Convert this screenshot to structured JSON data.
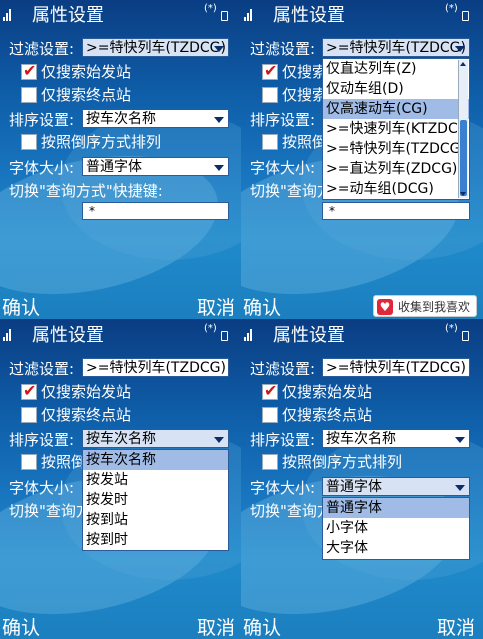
{
  "title": "属性设置",
  "bt_symbol": "(*)",
  "filter_label": "过滤设置:",
  "filter_value": ">=特快列车(TZDCG)",
  "search_start": "仅搜索始发站",
  "search_end": "仅搜索终点站",
  "sort_label": "排序设置:",
  "sort_value": "按车次名称",
  "reverse": "按照倒序方式排列",
  "font_label": "字体大小:",
  "font_value": "普通字体",
  "shortcut_label": "切换\"查询方式\"快捷键:",
  "shortcut_value": "*",
  "ok": "确认",
  "cancel": "取消",
  "filter_options": [
    "仅直达列车(Z)",
    "仅动车组(D)",
    "仅高速动车(CG)",
    ">=快速列车(KTZDCG)",
    ">=特快列车(TZDCG)",
    ">=直达列车(ZDCG)",
    ">=动车组(DCG)"
  ],
  "sort_options": [
    "按车次名称",
    "按发站",
    "按发时",
    "按到站",
    "按到时"
  ],
  "font_options": [
    "普通字体",
    "小字体",
    "大字体"
  ],
  "favorite": "收集到我喜欢"
}
